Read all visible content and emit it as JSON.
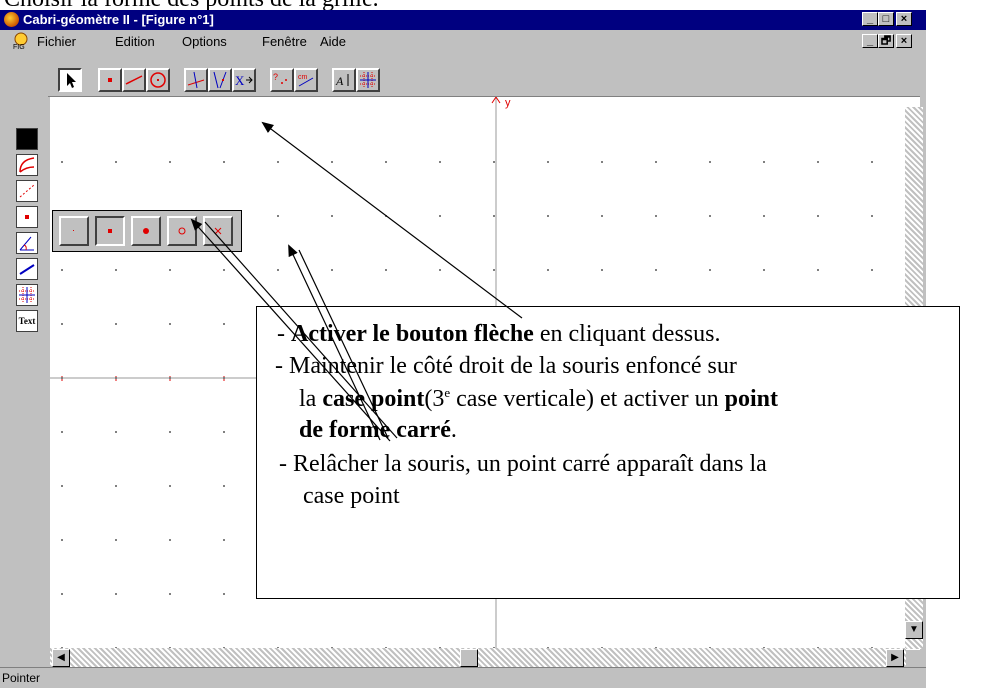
{
  "doc_heading": "Choisir la forme des points de la grille.",
  "window": {
    "title": "Cabri-géomètre II - [Figure n°1]",
    "title_buttons": [
      "_",
      "□",
      "×"
    ],
    "menu": [
      "Fichier",
      "Edition",
      "Options",
      "Fenêtre",
      "Aide"
    ],
    "doc_buttons": [
      "_",
      "🗗",
      "×"
    ]
  },
  "canvas": {
    "axis_y_label": "y"
  },
  "status": "Pointer",
  "left_toolbar": {
    "text_label": "Text"
  },
  "callout": {
    "line1_prefix": "- ",
    "line1_bold": "Activer le bouton flèche",
    "line1_rest": " en cliquant  dessus.",
    "line2": "- Maintenir le côté droit de la souris enfoncé sur",
    "line3_prefix": "la ",
    "line3_bold": "case point",
    "line3_mid": "(3",
    "line3_sup": "e",
    "line3_rest": " case verticale) et activer un ",
    "line3_bold2": "point",
    "line4_bold": "de forme carré",
    "line4_rest": ".",
    "line5": "- Relâcher la souris, un point carré apparaît dans la",
    "line6": "case point"
  },
  "colors": {
    "titlebar": "#000080",
    "chrome": "#c0c0c0",
    "accent_red": "#ff0000",
    "grid_point": "#808080"
  }
}
